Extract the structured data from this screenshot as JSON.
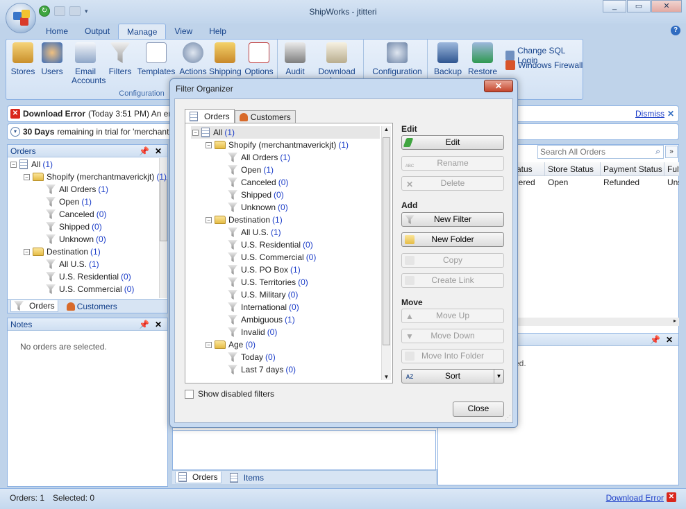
{
  "app": {
    "title": "ShipWorks - jtitteri"
  },
  "ribbon_tabs": [
    "Home",
    "Output",
    "Manage",
    "View",
    "Help"
  ],
  "ribbon": {
    "configuration_group": {
      "label": "Configuration",
      "buttons": [
        "Stores",
        "Users",
        "Email Accounts",
        "Filters",
        "Templates",
        "Actions",
        "Shipping",
        "Options"
      ]
    },
    "log_group": {
      "buttons": [
        "Audit",
        "Download Log"
      ]
    },
    "config_btn": "Configuration",
    "db_group": {
      "buttons": [
        "Backup",
        "Restore"
      ],
      "links": [
        "Change SQL Login",
        "Windows Firewall"
      ]
    }
  },
  "banners": {
    "download_error": {
      "title": "Download Error",
      "time": "(Today 3:51 PM) An erro",
      "dismiss": "Dismiss"
    },
    "trial": {
      "days": "30 Days",
      "text": "remaining in trial for 'merchantma"
    }
  },
  "left_panel": {
    "title": "Orders",
    "tree": [
      {
        "label": "All",
        "count": "(1)",
        "kind": "page",
        "level": 0,
        "exp": "−"
      },
      {
        "label": "Shopify (merchantmaverickjt)",
        "count": "(1)",
        "kind": "folder",
        "level": 1,
        "exp": "−"
      },
      {
        "label": "All Orders",
        "count": "(1)",
        "kind": "filter",
        "level": 2
      },
      {
        "label": "Open",
        "count": "(1)",
        "kind": "filter",
        "level": 2
      },
      {
        "label": "Canceled",
        "count": "(0)",
        "kind": "filter",
        "level": 2
      },
      {
        "label": "Shipped",
        "count": "(0)",
        "kind": "filter",
        "level": 2
      },
      {
        "label": "Unknown",
        "count": "(0)",
        "kind": "filter",
        "level": 2
      },
      {
        "label": "Destination",
        "count": "(1)",
        "kind": "folder",
        "level": 1,
        "exp": "−"
      },
      {
        "label": "All U.S.",
        "count": "(1)",
        "kind": "filter",
        "level": 2
      },
      {
        "label": "U.S. Residential",
        "count": "(0)",
        "kind": "filter",
        "level": 2
      },
      {
        "label": "U.S. Commercial",
        "count": "(0)",
        "kind": "filter",
        "level": 2
      }
    ],
    "tabs": [
      "Orders",
      "Customers"
    ]
  },
  "notes_panel": {
    "title": "Notes",
    "empty": "No orders are selected."
  },
  "grid": {
    "search_placeholder": "Search All Orders",
    "columns": [
      "atus",
      "Store Status",
      "Payment Status",
      "Fulf"
    ],
    "row": [
      "lered",
      "Open",
      "Refunded",
      "Uns"
    ]
  },
  "right_lower": {
    "text": "ed."
  },
  "center_tabs": [
    "Orders",
    "Items"
  ],
  "status": {
    "orders": "Orders: 1",
    "selected": "Selected: 0",
    "download_error": "Download Error"
  },
  "dialog": {
    "title": "Filter Organizer",
    "tabs": [
      "Orders",
      "Customers"
    ],
    "tree": [
      {
        "label": "All",
        "count": "(1)",
        "kind": "page",
        "level": 0,
        "exp": "−"
      },
      {
        "label": "Shopify (merchantmaverickjt)",
        "count": "(1)",
        "kind": "folder",
        "level": 1,
        "exp": "−"
      },
      {
        "label": "All Orders",
        "count": "(1)",
        "kind": "filter",
        "level": 2
      },
      {
        "label": "Open",
        "count": "(1)",
        "kind": "filter",
        "level": 2
      },
      {
        "label": "Canceled",
        "count": "(0)",
        "kind": "filter",
        "level": 2
      },
      {
        "label": "Shipped",
        "count": "(0)",
        "kind": "filter",
        "level": 2
      },
      {
        "label": "Unknown",
        "count": "(0)",
        "kind": "filter",
        "level": 2
      },
      {
        "label": "Destination",
        "count": "(1)",
        "kind": "folder",
        "level": 1,
        "exp": "−"
      },
      {
        "label": "All U.S.",
        "count": "(1)",
        "kind": "filter",
        "level": 2
      },
      {
        "label": "U.S. Residential",
        "count": "(0)",
        "kind": "filter",
        "level": 2
      },
      {
        "label": "U.S. Commercial",
        "count": "(0)",
        "kind": "filter",
        "level": 2
      },
      {
        "label": "U.S. PO Box",
        "count": "(1)",
        "kind": "filter",
        "level": 2
      },
      {
        "label": "U.S. Territories",
        "count": "(0)",
        "kind": "filter",
        "level": 2
      },
      {
        "label": "U.S. Military",
        "count": "(0)",
        "kind": "filter",
        "level": 2
      },
      {
        "label": "International",
        "count": "(0)",
        "kind": "filter",
        "level": 2
      },
      {
        "label": "Ambiguous",
        "count": "(1)",
        "kind": "filter",
        "level": 2
      },
      {
        "label": "Invalid",
        "count": "(0)",
        "kind": "filter",
        "level": 2
      },
      {
        "label": "Age",
        "count": "(0)",
        "kind": "folder",
        "level": 1,
        "exp": "−"
      },
      {
        "label": "Today",
        "count": "(0)",
        "kind": "filter",
        "level": 2
      },
      {
        "label": "Last 7 days",
        "count": "(0)",
        "kind": "filter",
        "level": 2
      }
    ],
    "sections": {
      "edit": "Edit",
      "add": "Add",
      "move": "Move"
    },
    "buttons": {
      "edit": "Edit",
      "rename": "Rename",
      "delete": "Delete",
      "new_filter": "New Filter",
      "new_folder": "New Folder",
      "copy": "Copy",
      "create_link": "Create Link",
      "move_up": "Move Up",
      "move_down": "Move Down",
      "move_into_folder": "Move Into Folder",
      "sort": "Sort",
      "close": "Close"
    },
    "show_disabled": "Show disabled filters"
  }
}
